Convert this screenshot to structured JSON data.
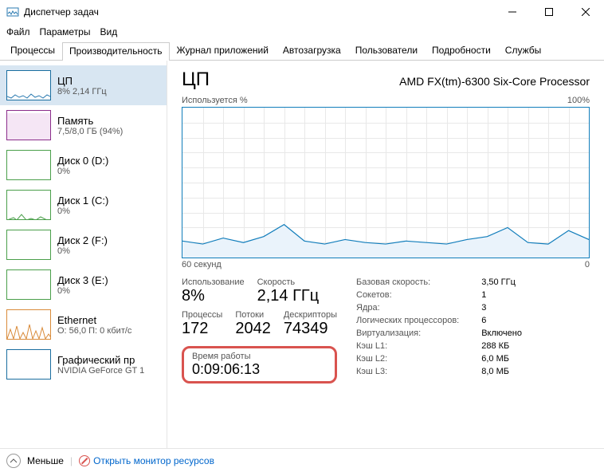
{
  "window": {
    "title": "Диспетчер задач"
  },
  "menu": {
    "file": "Файл",
    "options": "Параметры",
    "view": "Вид"
  },
  "tabs": {
    "processes": "Процессы",
    "performance": "Производительность",
    "app_history": "Журнал приложений",
    "startup": "Автозагрузка",
    "users": "Пользователи",
    "details": "Подробности",
    "services": "Службы"
  },
  "sidebar": [
    {
      "name": "ЦП",
      "sub": "8% 2,14 ГГц",
      "kind": "cpu",
      "selected": true
    },
    {
      "name": "Память",
      "sub": "7,5/8,0 ГБ (94%)",
      "kind": "mem"
    },
    {
      "name": "Диск 0 (D:)",
      "sub": "0%",
      "kind": "disk"
    },
    {
      "name": "Диск 1 (C:)",
      "sub": "0%",
      "kind": "disk"
    },
    {
      "name": "Диск 2 (F:)",
      "sub": "0%",
      "kind": "disk"
    },
    {
      "name": "Диск 3 (E:)",
      "sub": "0%",
      "kind": "disk"
    },
    {
      "name": "Ethernet",
      "sub": "О: 56,0 П: 0 кбит/с",
      "kind": "eth"
    },
    {
      "name": "Графический пр",
      "sub": "NVIDIA GeForce GT 1",
      "kind": "gpu"
    }
  ],
  "cpu": {
    "heading": "ЦП",
    "model": "AMD FX(tm)-6300 Six-Core Processor",
    "util_label": "Используется %",
    "util_max": "100%",
    "x_left": "60 секунд",
    "x_right": "0",
    "stats": {
      "usage_lbl": "Использование",
      "usage_val": "8%",
      "speed_lbl": "Скорость",
      "speed_val": "2,14 ГГц",
      "processes_lbl": "Процессы",
      "processes_val": "172",
      "threads_lbl": "Потоки",
      "threads_val": "2042",
      "handles_lbl": "Дескрипторы",
      "handles_val": "74349",
      "uptime_lbl": "Время работы",
      "uptime_val": "0:09:06:13"
    },
    "info": {
      "base_speed_k": "Базовая скорость:",
      "base_speed_v": "3,50 ГГц",
      "sockets_k": "Сокетов:",
      "sockets_v": "1",
      "cores_k": "Ядра:",
      "cores_v": "3",
      "lp_k": "Логических процессоров:",
      "lp_v": "6",
      "virt_k": "Виртуализация:",
      "virt_v": "Включено",
      "l1_k": "Кэш L1:",
      "l1_v": "288 КБ",
      "l2_k": "Кэш L2:",
      "l2_v": "6,0 МБ",
      "l3_k": "Кэш L3:",
      "l3_v": "8,0 МБ"
    }
  },
  "footer": {
    "fewer": "Меньше",
    "resmon": "Открыть монитор ресурсов"
  },
  "chart_data": {
    "type": "line",
    "title": "ЦП — Используется %",
    "xlabel": "секунд",
    "ylabel": "%",
    "ylim": [
      0,
      100
    ],
    "x": [
      60,
      57,
      54,
      51,
      48,
      45,
      42,
      39,
      36,
      33,
      30,
      27,
      24,
      21,
      18,
      15,
      12,
      9,
      6,
      3,
      0
    ],
    "values": [
      11,
      9,
      13,
      10,
      14,
      22,
      11,
      9,
      12,
      10,
      9,
      11,
      10,
      9,
      12,
      14,
      20,
      10,
      9,
      18,
      12
    ]
  }
}
